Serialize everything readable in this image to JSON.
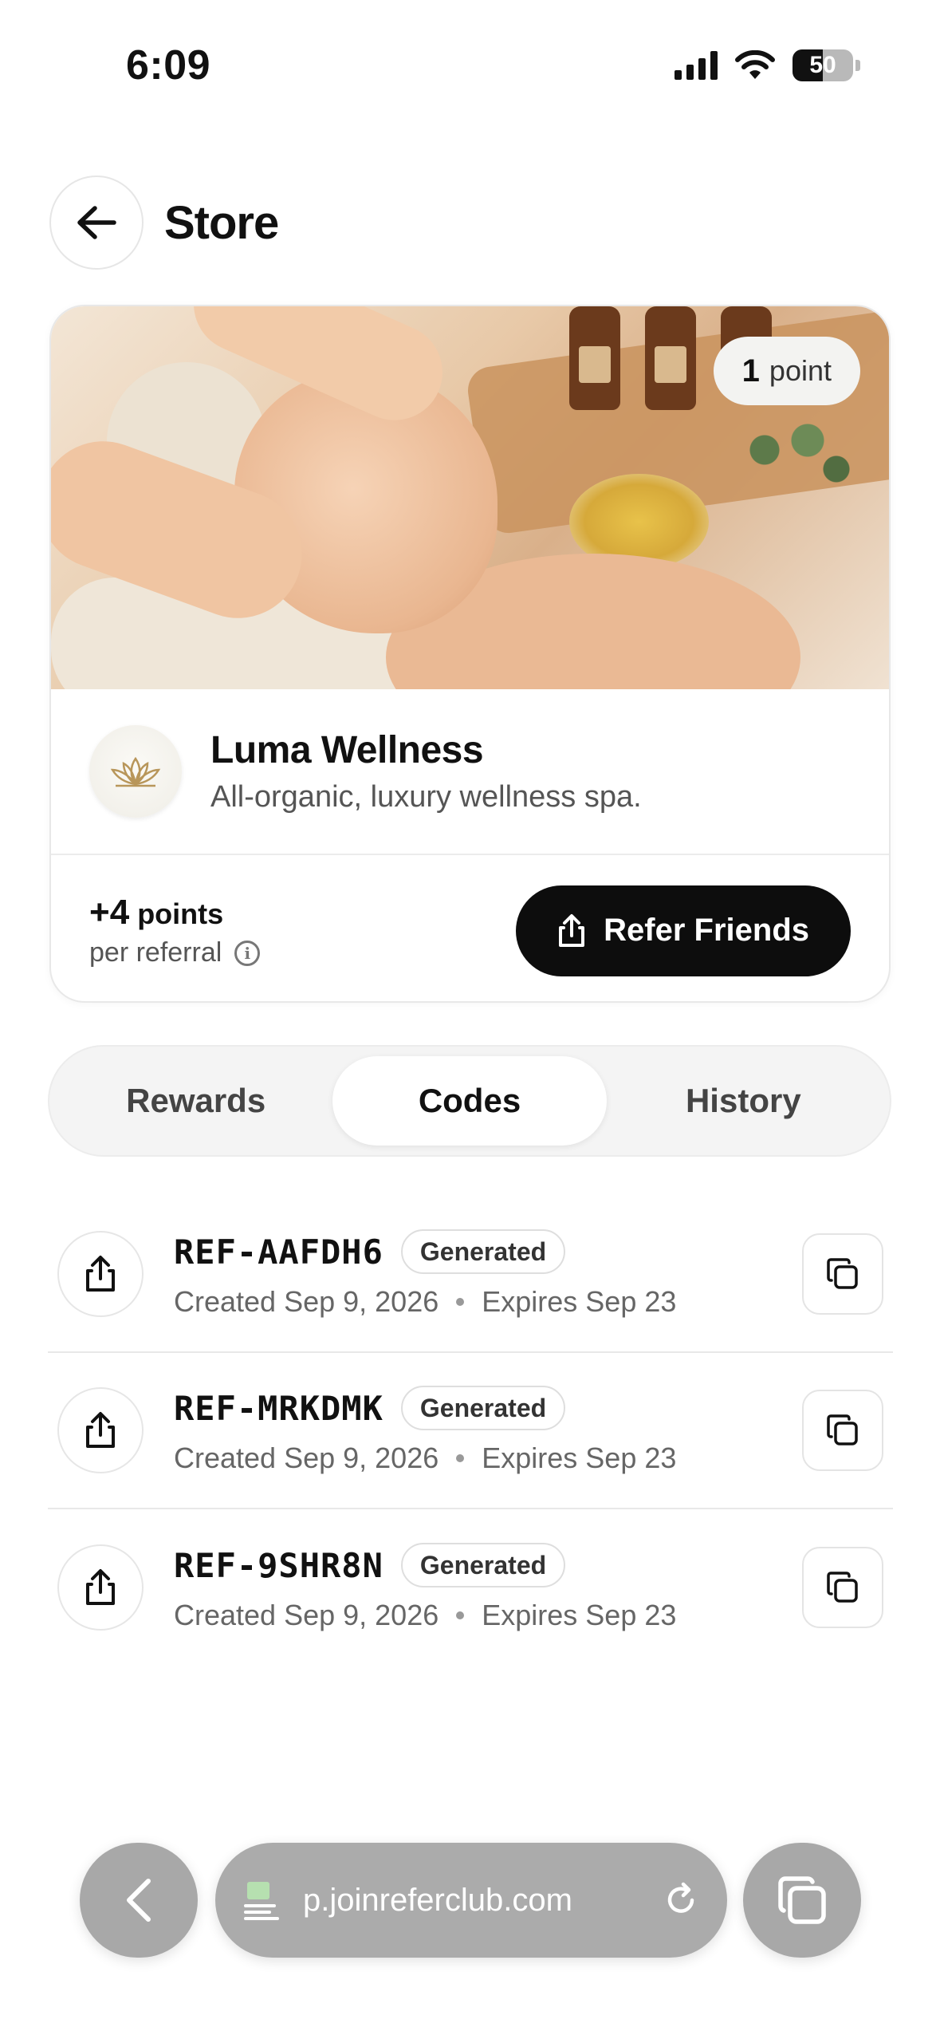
{
  "status_bar": {
    "time": "6:09",
    "battery": "50",
    "battery_level": 0.5
  },
  "header": {
    "title": "Store"
  },
  "store": {
    "points_cost_number": "1",
    "points_cost_unit": "point",
    "name": "Luma Wellness",
    "description": "All-organic, luxury wellness spa.",
    "referral_points": "+4",
    "referral_points_unit": "points",
    "referral_sub": "per referral",
    "refer_button": "Refer Friends"
  },
  "tabs": [
    {
      "label": "Rewards",
      "active": false
    },
    {
      "label": "Codes",
      "active": true
    },
    {
      "label": "History",
      "active": false
    }
  ],
  "codes": [
    {
      "code": "REF-AAFDH6",
      "status": "Generated",
      "created": "Created Sep 9, 2026",
      "expires": "Expires Sep 23"
    },
    {
      "code": "REF-MRKDMK",
      "status": "Generated",
      "created": "Created Sep 9, 2026",
      "expires": "Expires Sep 23"
    },
    {
      "code": "REF-9SHR8N",
      "status": "Generated",
      "created": "Created Sep 9, 2026",
      "expires": "Expires Sep 23"
    }
  ],
  "browser": {
    "url": "p.joinreferclub.com"
  },
  "colors": {
    "primary_button": "#0d0d0d",
    "tab_bg": "#f4f4f4",
    "muted_text": "#666666"
  }
}
